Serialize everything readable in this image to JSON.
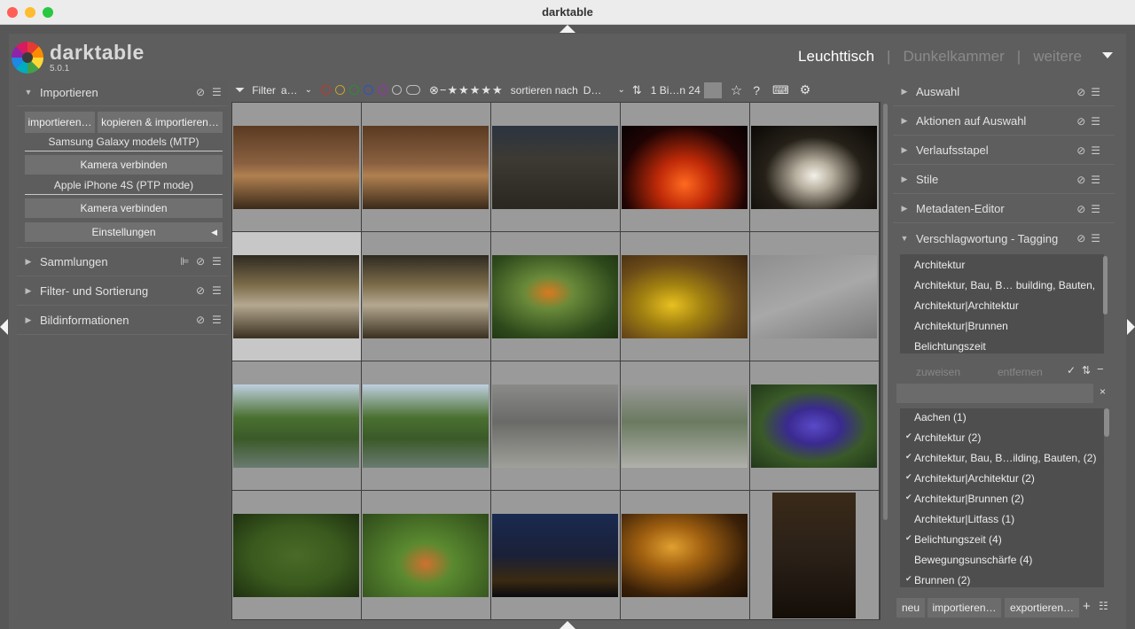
{
  "window": {
    "title": "darktable"
  },
  "header": {
    "app_name": "darktable",
    "version": "5.0.1",
    "views": [
      {
        "label": "Leuchttisch"
      },
      {
        "label": "Dunkelkammer"
      },
      {
        "label": "weitere"
      }
    ],
    "separator": "|"
  },
  "left": {
    "import": {
      "title": "Importieren",
      "btn_import": "importieren…",
      "btn_copy_import": "kopieren & importieren…",
      "device1": "Samsung Galaxy models (MTP)",
      "connect1": "Kamera verbinden",
      "device2": "Apple iPhone 4S (PTP mode)",
      "connect2": "Kamera verbinden",
      "settings": "Einstellungen"
    },
    "modules": [
      {
        "label": "Sammlungen"
      },
      {
        "label": "Filter- und Sortierung"
      },
      {
        "label": "Bildinformationen"
      }
    ]
  },
  "toolbar": {
    "filter_label": "Filter",
    "filter_value": "a…",
    "sort_label": "sortieren nach",
    "sort_value": "D…",
    "count": "1 Bi…n 24"
  },
  "thumbs": [
    {
      "name": "bread-1"
    },
    {
      "name": "bread-2"
    },
    {
      "name": "building-night"
    },
    {
      "name": "fireworks-red"
    },
    {
      "name": "fireworks-white"
    },
    {
      "name": "cascade-1"
    },
    {
      "name": "cascade-2"
    },
    {
      "name": "butterfly-orange"
    },
    {
      "name": "yellow-flowers"
    },
    {
      "name": "fly"
    },
    {
      "name": "fountain-1"
    },
    {
      "name": "fountain-2"
    },
    {
      "name": "cyclists-1"
    },
    {
      "name": "cyclist-2"
    },
    {
      "name": "blue-flower"
    },
    {
      "name": "butterfly-leaves"
    },
    {
      "name": "orange-flower"
    },
    {
      "name": "city-night"
    },
    {
      "name": "photographer-1"
    },
    {
      "name": "photographer-2"
    }
  ],
  "right": {
    "modules": [
      {
        "label": "Auswahl"
      },
      {
        "label": "Aktionen auf Auswahl"
      },
      {
        "label": "Verlaufsstapel"
      },
      {
        "label": "Stile"
      },
      {
        "label": "Metadaten-Editor"
      },
      {
        "label": "Verschlagwortung - Tagging"
      }
    ],
    "attached_tags": [
      "Architektur",
      "Architektur, Bau, B… building, Bauten,",
      "Architektur|Architektur",
      "Architektur|Brunnen",
      "Belichtungszeit"
    ],
    "assign": "zuweisen",
    "remove": "entfernen",
    "dictionary": [
      {
        "label": "Aachen (1)",
        "checked": false
      },
      {
        "label": "Architektur (2)",
        "checked": true
      },
      {
        "label": "Architektur, Bau, B…ilding, Bauten, (2)",
        "checked": true
      },
      {
        "label": "Architektur|Architektur (2)",
        "checked": true
      },
      {
        "label": "Architektur|Brunnen (2)",
        "checked": true
      },
      {
        "label": "Architektur|Litfass (1)",
        "checked": false
      },
      {
        "label": "Belichtungszeit (4)",
        "checked": true
      },
      {
        "label": "Bewegungsunschärfe (4)",
        "checked": false
      },
      {
        "label": "Brunnen (2)",
        "checked": true
      }
    ],
    "bottom_buttons": {
      "new": "neu",
      "import": "importieren…",
      "export": "exportieren…"
    }
  }
}
